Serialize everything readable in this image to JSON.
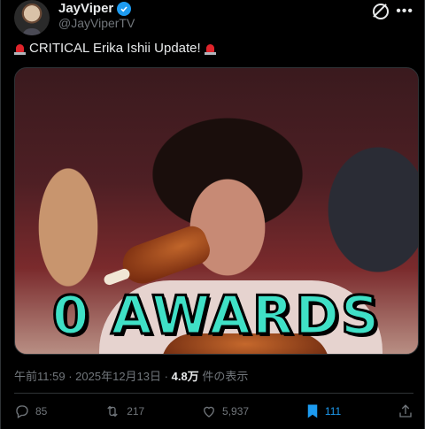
{
  "author": {
    "name": "JayViper",
    "handle": "@JayViperTV"
  },
  "tweet": {
    "text": "CRITICAL Erika Ishii Update!",
    "media_overlay_text": "0 AWARDS"
  },
  "meta": {
    "time": "午前11:59",
    "separator": "·",
    "date": "2025年12月13日",
    "views_count": "4.8万",
    "views_label": "件の表示"
  },
  "actions": {
    "replies": "85",
    "reposts": "217",
    "likes": "5,937",
    "bookmarks": "111"
  },
  "colors": {
    "accent": "#1d9bf0",
    "overlay_text": "#3fe0c6"
  }
}
